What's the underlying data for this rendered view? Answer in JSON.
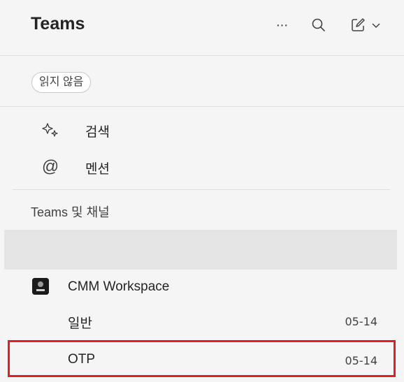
{
  "header": {
    "title": "Teams",
    "more_glyph": "···",
    "icons": [
      "more-icon",
      "search-icon",
      "compose-icon",
      "chevron-down-icon"
    ]
  },
  "filter": {
    "chip_label": "읽지 않음"
  },
  "nav": {
    "items": [
      {
        "label": "검색",
        "icon": "sparkle-icon"
      },
      {
        "label": "멘션",
        "icon": "at-icon",
        "glyph": "@"
      }
    ]
  },
  "section": {
    "label": "Teams 및 채널"
  },
  "team": {
    "name": "CMM Workspace",
    "channels": [
      {
        "name": "일반",
        "date": "05-14"
      },
      {
        "name": "OTP",
        "date": "05-14"
      }
    ]
  },
  "colors": {
    "background": "#f5f5f5",
    "selected_row": "#e5e5e5",
    "highlight_border": "#e01e23",
    "text": "#242424"
  }
}
